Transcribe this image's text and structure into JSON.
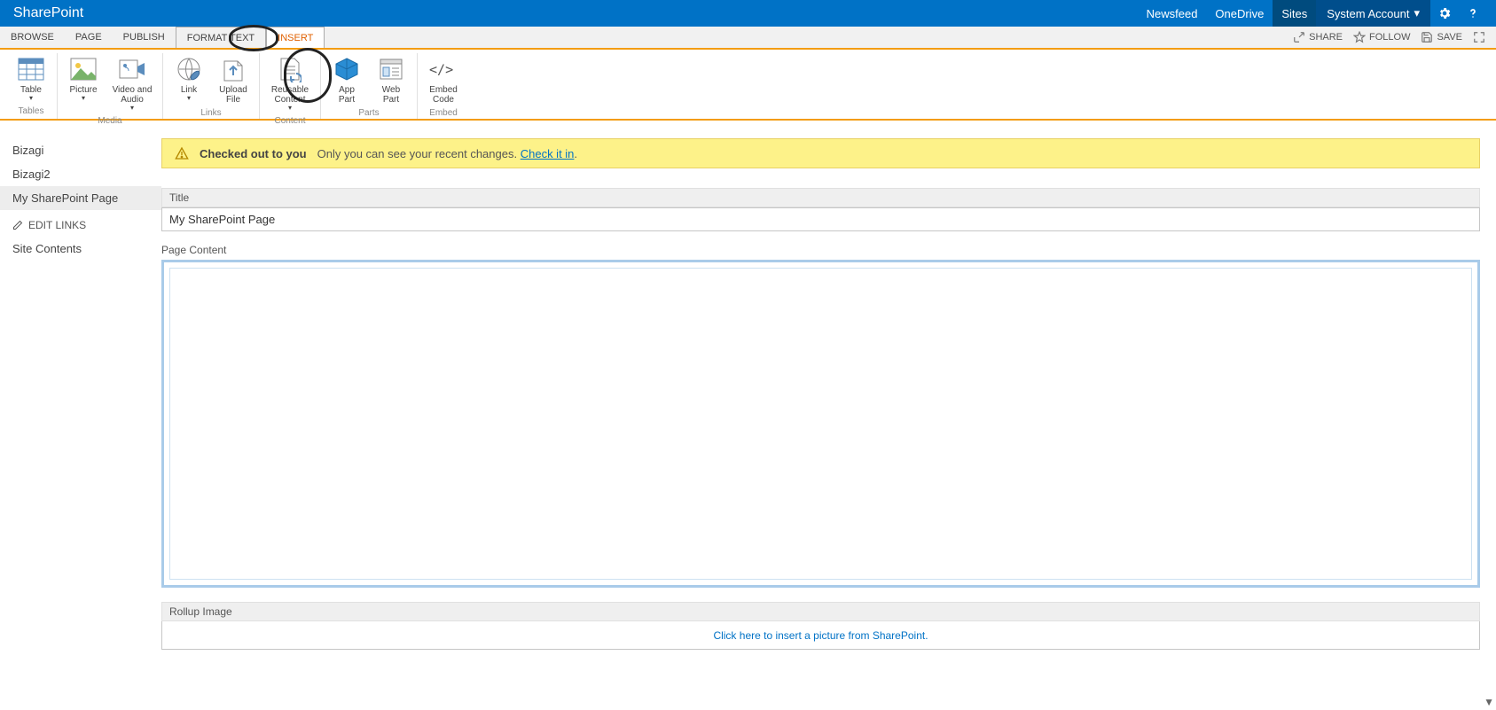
{
  "top": {
    "brand": "SharePoint",
    "links": [
      "Newsfeed",
      "OneDrive",
      "Sites"
    ],
    "user": "System Account"
  },
  "tabs": {
    "items": [
      "BROWSE",
      "PAGE",
      "PUBLISH",
      "FORMAT TEXT",
      "INSERT"
    ],
    "actions": {
      "share": "SHARE",
      "follow": "FOLLOW",
      "save": "SAVE"
    }
  },
  "ribbon": {
    "groups": [
      {
        "label": "Tables",
        "buttons": [
          {
            "label": "Table",
            "sub": "",
            "drop": true
          }
        ]
      },
      {
        "label": "Media",
        "buttons": [
          {
            "label": "Picture",
            "drop": true
          },
          {
            "label": "Video and Audio",
            "drop": true
          }
        ]
      },
      {
        "label": "Links",
        "buttons": [
          {
            "label": "Link",
            "drop": true
          },
          {
            "label": "Upload File"
          }
        ]
      },
      {
        "label": "Content",
        "buttons": [
          {
            "label": "Reusable Content",
            "drop": true
          }
        ]
      },
      {
        "label": "Parts",
        "buttons": [
          {
            "label": "App Part"
          },
          {
            "label": "Web Part"
          }
        ]
      },
      {
        "label": "Embed",
        "buttons": [
          {
            "label": "Embed Code"
          }
        ]
      }
    ]
  },
  "sidebar": {
    "items": [
      "Bizagi",
      "Bizagi2",
      "My SharePoint Page"
    ],
    "edit": "EDIT LINKS",
    "contents": "Site Contents"
  },
  "notif": {
    "bold": "Checked out to you",
    "text": "Only you can see your recent changes.",
    "link": "Check it in"
  },
  "form": {
    "titleLabel": "Title",
    "titleValue": "My SharePoint Page",
    "contentLabel": "Page Content",
    "rollupLabel": "Rollup Image",
    "rollupLink": "Click here to insert a picture from SharePoint."
  }
}
